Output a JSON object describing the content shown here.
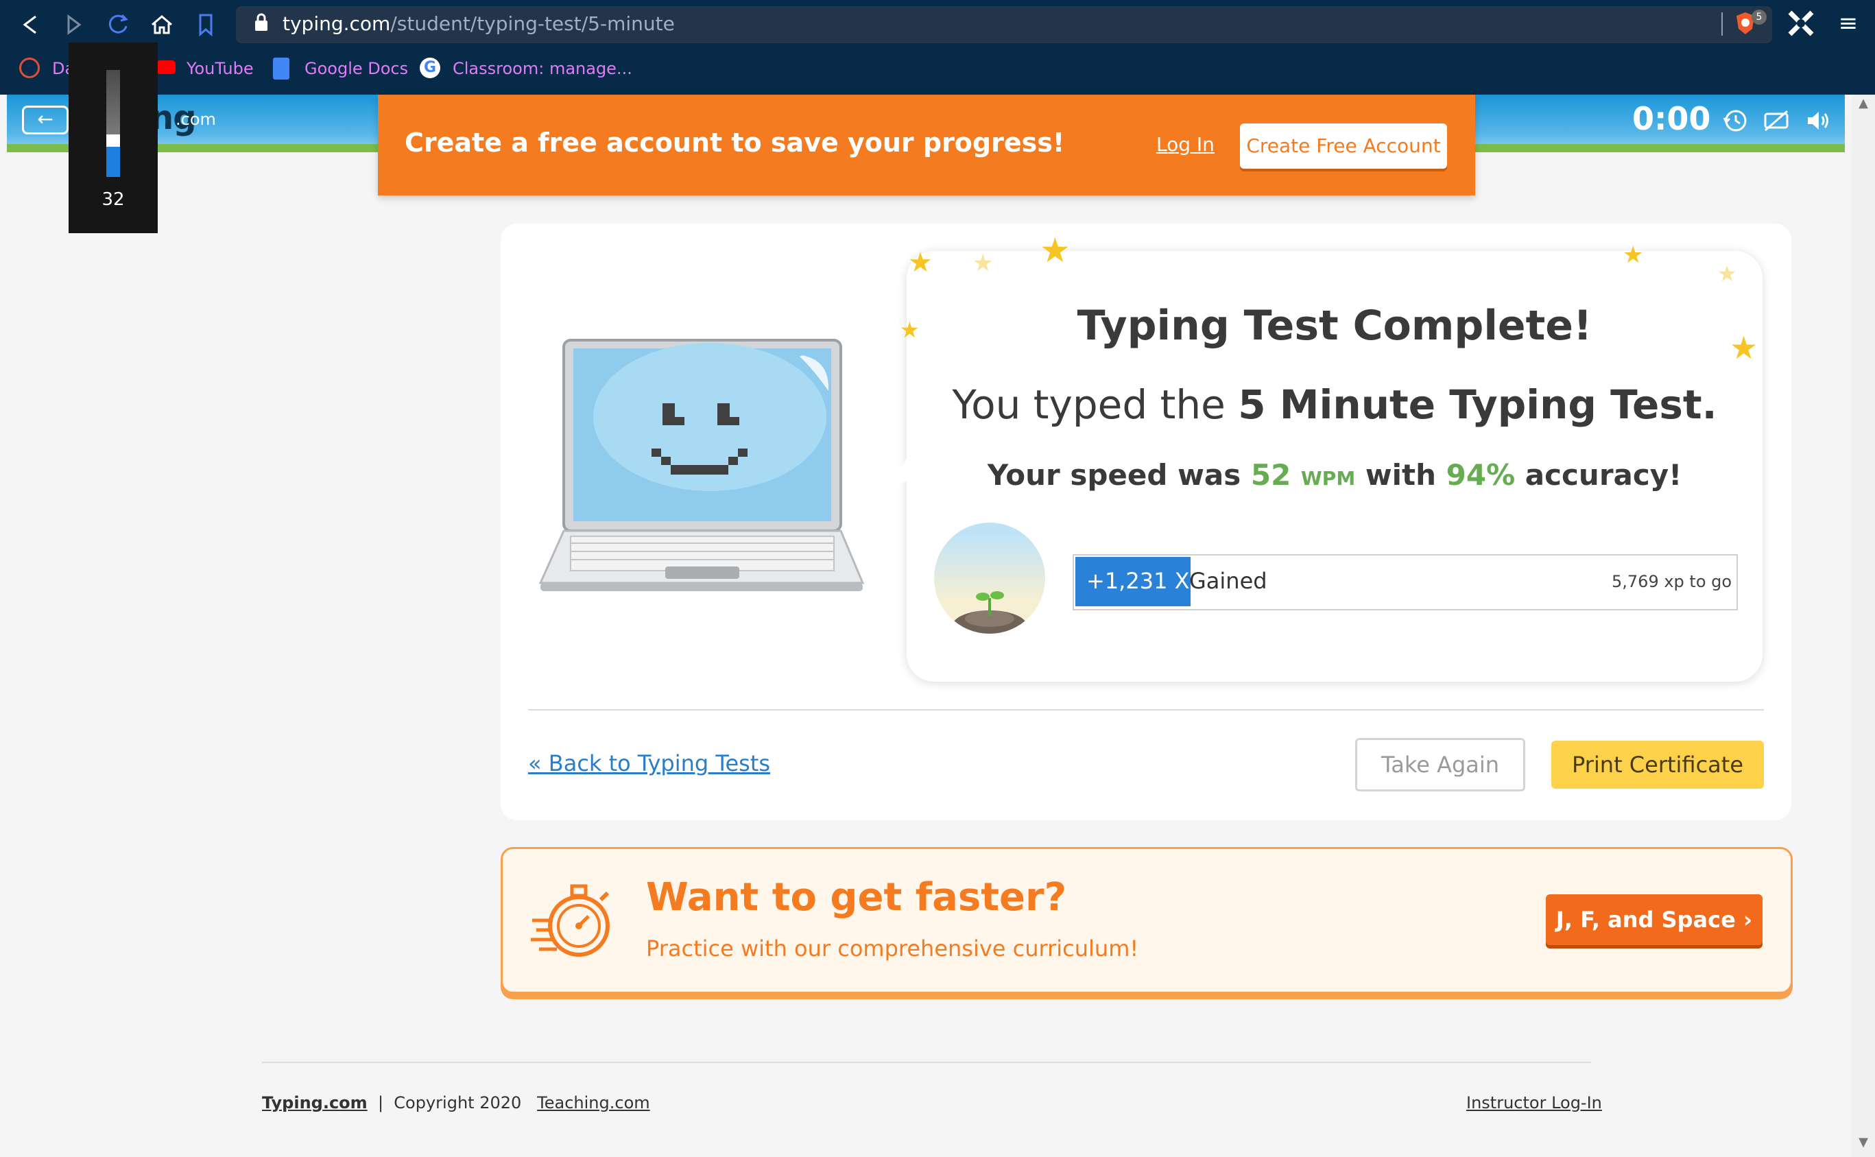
{
  "browser": {
    "url_host": "typing.com",
    "url_path": "/student/typing-test/5-minute",
    "shield_count": "5",
    "bookmarks": [
      {
        "label": "Da",
        "icon": "dashboard-icon"
      },
      {
        "label": "YouTube",
        "icon": "youtube-icon"
      },
      {
        "label": "Google Docs",
        "icon": "google-docs-icon"
      },
      {
        "label": "Classroom: manage...",
        "icon": "google-icon"
      }
    ]
  },
  "volume_overlay": {
    "value": "32",
    "level": 0.32
  },
  "header": {
    "logo": "typing",
    "logo_suffix": ".com",
    "timer": "0:00"
  },
  "banner": {
    "text": "Create a free account to save your progress!",
    "login": "Log In",
    "create": "Create Free Account"
  },
  "result": {
    "title": "Typing Test Complete!",
    "typed_prefix": "You typed the ",
    "test_name": "5 Minute Typing Test.",
    "speed_prefix": "Your speed was ",
    "wpm": "52",
    "wpm_unit": "WPM",
    "with": " with ",
    "accuracy": "94%",
    "accuracy_suffix": " accuracy!",
    "xp_gain": "+1,231 XP",
    "xp_gained_label": "Gained",
    "xp_to_go": "5,769 xp to go",
    "xp_progress": 0.176
  },
  "actions": {
    "back": "« Back to Typing Tests",
    "take_again": "Take Again",
    "print_certificate": "Print Certificate"
  },
  "promo": {
    "title": "Want to get faster?",
    "subtitle": "Practice with our comprehensive curriculum!",
    "button": "J, F, and Space ›"
  },
  "footer": {
    "brand": "Typing.com",
    "copyright": "Copyright 2020",
    "teaching": "Teaching.com",
    "instructor": "Instructor Log-In"
  },
  "colors": {
    "orange": "#f47b1f",
    "green": "#66ad52",
    "blue": "#2a82d8",
    "yellow": "#fdd14a",
    "browser_bg": "#062a48"
  }
}
